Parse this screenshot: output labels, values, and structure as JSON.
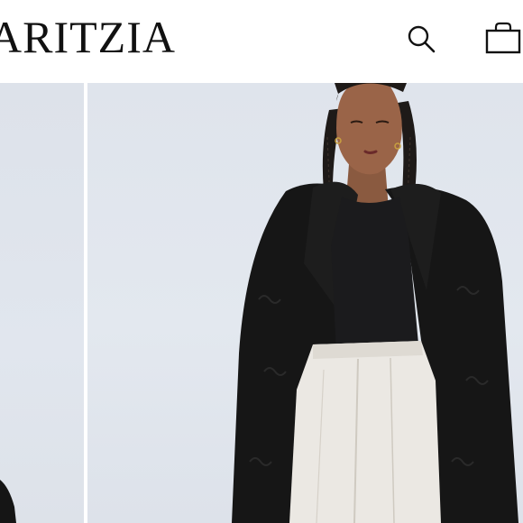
{
  "header": {
    "brand": "ARITZIA",
    "search_icon": "search-icon",
    "bag_icon": "shopping-bag-icon"
  },
  "gallery": {
    "images": [
      {
        "name": "product-image-previous"
      },
      {
        "name": "product-image-faux-fur-coat"
      }
    ]
  },
  "colors": {
    "background": "#ffffff",
    "text": "#111111",
    "photo_backdrop": "#e0e5ed",
    "coat": "#161616",
    "top": "#1b1b1d",
    "trousers": "#ebe8e3"
  }
}
